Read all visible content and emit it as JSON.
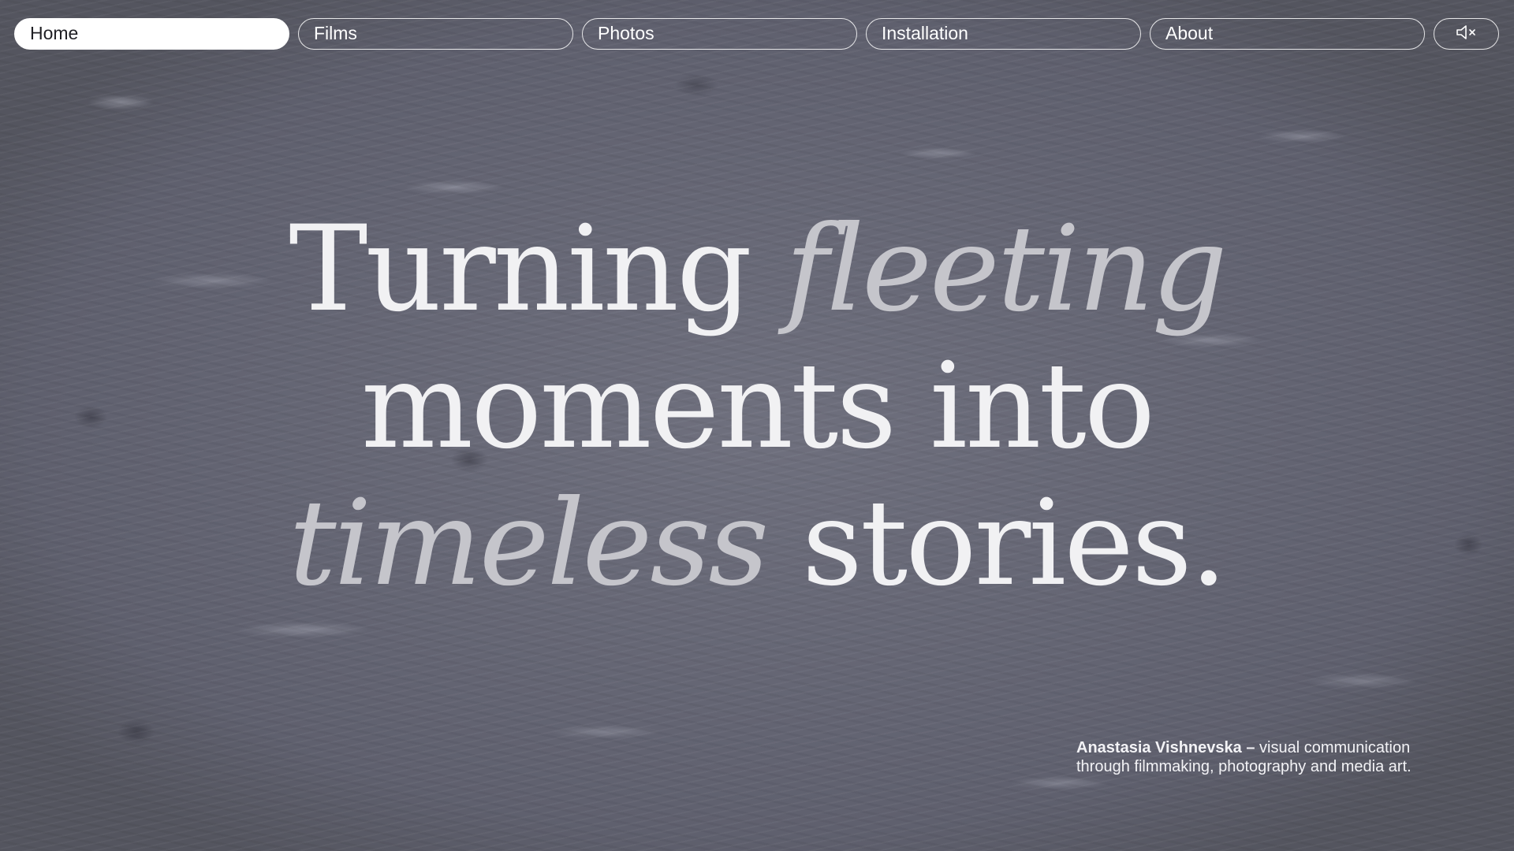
{
  "nav": {
    "items": [
      {
        "label": "Home",
        "active": true
      },
      {
        "label": "Films",
        "active": false
      },
      {
        "label": "Photos",
        "active": false
      },
      {
        "label": "Installation",
        "active": false
      },
      {
        "label": "About",
        "active": false
      }
    ],
    "sound_icon": "speaker-muted-icon"
  },
  "hero": {
    "word1": "Turning",
    "word2_italic": "fleeting",
    "line2": "moments into",
    "word3_italic": "timeless",
    "word4": "stories."
  },
  "credit": {
    "name": "Anastasia Vishnevska –",
    "line1_rest": "visual communication",
    "line2": "through filmmaking, photography and media art."
  },
  "colors": {
    "background": "#6b6c7a",
    "nav_active_bg": "#ffffff",
    "text": "#f1f1f3",
    "italic_text": "#c5c5cb"
  }
}
